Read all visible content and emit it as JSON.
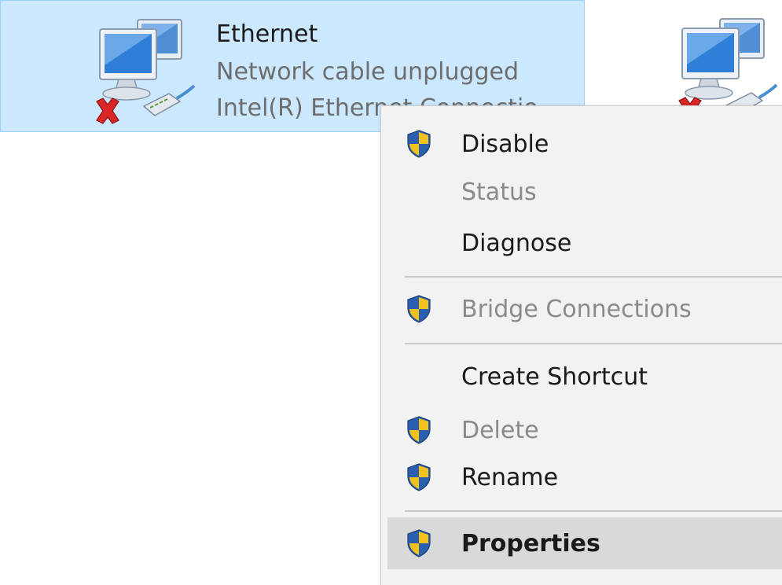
{
  "adapter": {
    "name": "Ethernet",
    "status": "Network cable unplugged",
    "device": "Intel(R) Ethernet Connectio"
  },
  "icons": {
    "adapter": "network-adapter-icon",
    "disconnected": "red-x-icon",
    "cable": "ethernet-cable-icon",
    "uac": "uac-shield-icon"
  },
  "colors": {
    "selection_bg": "#cce8ff",
    "selection_border": "#99d1ff",
    "menu_bg": "#f2f2f2",
    "menu_highlight": "#d9d9d9",
    "disabled_text": "#8a8a8a"
  },
  "context_menu": {
    "items": [
      {
        "label": "Disable",
        "shield": true,
        "disabled": false
      },
      {
        "label": "Status",
        "shield": false,
        "disabled": true
      },
      {
        "label": "Diagnose",
        "shield": false,
        "disabled": false
      },
      {
        "label": "Bridge Connections",
        "shield": true,
        "disabled": true
      },
      {
        "label": "Create Shortcut",
        "shield": false,
        "disabled": false
      },
      {
        "label": "Delete",
        "shield": true,
        "disabled": true
      },
      {
        "label": "Rename",
        "shield": true,
        "disabled": false
      },
      {
        "label": "Properties",
        "shield": true,
        "disabled": false,
        "bold": true,
        "highlighted": true
      }
    ]
  }
}
